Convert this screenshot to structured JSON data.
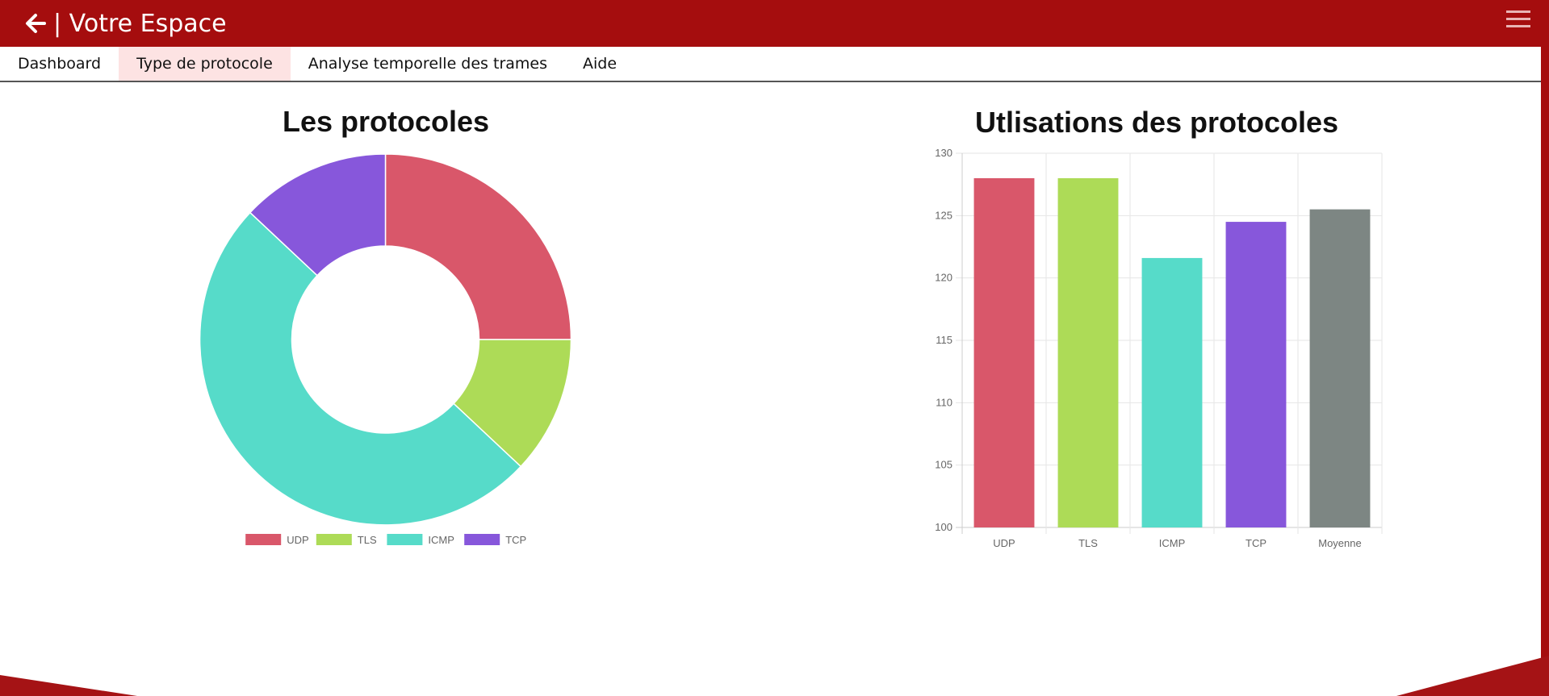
{
  "header": {
    "title": "| Votre Espace",
    "bg_color": "#a50d0e",
    "back_icon": "arrow-left-icon",
    "menu_icon": "hamburger-menu-icon"
  },
  "nav": {
    "tabs": [
      {
        "label": "Dashboard",
        "active": false
      },
      {
        "label": "Type de protocole",
        "active": true
      },
      {
        "label": "Analyse temporelle des trames",
        "active": false
      },
      {
        "label": "Aide",
        "active": false
      }
    ],
    "active_bg": "#fde3e3"
  },
  "chart_data": [
    {
      "type": "pie",
      "variant": "doughnut",
      "title": "Les protocoles",
      "categories": [
        "UDP",
        "TLS",
        "ICMP",
        "TCP"
      ],
      "values": [
        25,
        12,
        50,
        13
      ],
      "colors": [
        "#d9576a",
        "#addb57",
        "#56dbc9",
        "#8757db"
      ],
      "legend": "bottom"
    },
    {
      "type": "bar",
      "title": "Utlisations des protocoles",
      "categories": [
        "UDP",
        "TLS",
        "ICMP",
        "TCP",
        "Moyenne"
      ],
      "values": [
        128,
        128,
        121.6,
        124.5,
        125.5
      ],
      "colors": [
        "#d9576a",
        "#addb57",
        "#56dbc9",
        "#8757db",
        "#7d8683"
      ],
      "ylim": [
        100,
        130
      ],
      "yticks": [
        "100",
        "105",
        "110",
        "115",
        "120",
        "125",
        "130"
      ],
      "grid": true
    }
  ]
}
